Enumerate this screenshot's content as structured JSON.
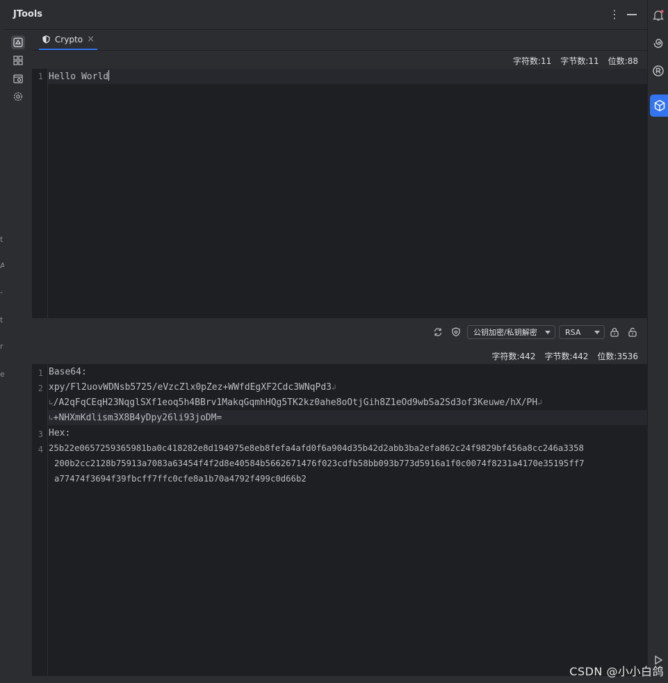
{
  "app": {
    "title": "JTools"
  },
  "left_strip": {
    "fragments": [
      "t",
      "A",
      "-",
      "t",
      "r",
      "e"
    ]
  },
  "tab": {
    "label": "Crypto",
    "close": "×"
  },
  "input_stats": {
    "chars": "字符数:11",
    "bytes": "字节数:11",
    "bits": "位数:88"
  },
  "input_editor": {
    "line_numbers": [
      "1"
    ],
    "lines": [
      "Hello World"
    ]
  },
  "toolbar": {
    "mode_select": "公钥加密/私钥解密",
    "algorithm_select": "RSA"
  },
  "output_stats": {
    "chars": "字符数:442",
    "bytes": "字节数:442",
    "bits": "位数:3536"
  },
  "output_editor": {
    "line_numbers": [
      "1",
      "2",
      "",
      "",
      "3",
      "4",
      "",
      ""
    ],
    "lines": [
      "Base64:",
      "xpy/Fl2uovWDNsb5725/eVzcZlx0pZez+WWfdEgXF2Cdc3WNqPd3",
      "/A2qFqCEqH23NqglSXf1eoq5h4BBrv1MakqGqmhHQg5TK2kz0ahe8oOtjGih8Z1eOd9wbSa2Sd3of3Keuwe/hX/PH",
      "+NHXmKdlism3X8B4yDpy26li93joDM=",
      "Hex:",
      "25b22e0657259365981ba0c418282e8d194975e8eb8fefa4afd0f6a904d35b42d2abb3ba2efa862c24f9829bf456a8cc246a3358",
      "200b2cc2128b75913a7083a63454f4f2d8e40584b5662671476f023cdfb58bb093b773d5916a1f0c0074f8231a4170e35195ff7",
      "a77474f3694f39fbcff7ffc0cfe8a1b70a4792f499c0d66b2"
    ]
  },
  "watermark": "CSDN @小小白鸽",
  "colors": {
    "accent": "#3574f0",
    "background": "#1e1f22",
    "panel": "#2b2d30"
  }
}
